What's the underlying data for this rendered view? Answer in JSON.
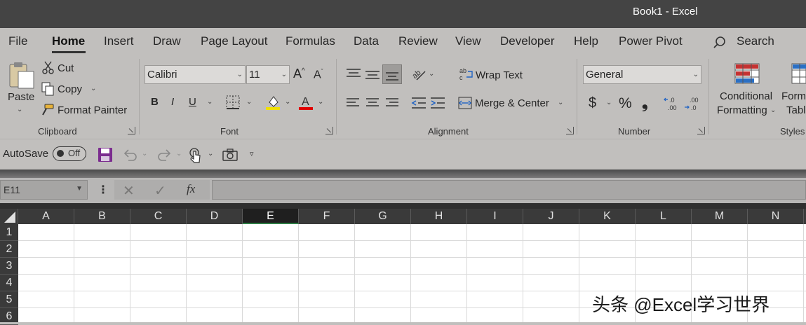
{
  "window": {
    "title": "Book1  -  Excel"
  },
  "tabs": [
    "File",
    "Home",
    "Insert",
    "Draw",
    "Page Layout",
    "Formulas",
    "Data",
    "Review",
    "View",
    "Developer",
    "Help",
    "Power Pivot"
  ],
  "search": {
    "label": "Search"
  },
  "clipboard": {
    "paste": "Paste",
    "cut": "Cut",
    "copy": "Copy",
    "format_painter": "Format Painter",
    "label": "Clipboard"
  },
  "font": {
    "name": "Calibri",
    "size": "11",
    "bold": "B",
    "italic": "I",
    "underline": "U",
    "label": "Font",
    "highlight_color": "#f0e000",
    "font_color": "#e00000"
  },
  "alignment": {
    "wrap_text": "Wrap Text",
    "merge_center": "Merge & Center",
    "label": "Alignment"
  },
  "number": {
    "format": "General",
    "currency": "$",
    "percent": "%",
    "comma": "❟",
    "label": "Number"
  },
  "styles": {
    "conditional_line1": "Conditional",
    "conditional_line2": "Formatting",
    "format_table_line1": "Forma",
    "format_table_line2": "Tabl",
    "label": "Styles"
  },
  "qat": {
    "autosave": "AutoSave",
    "toggle": "Off"
  },
  "formula_bar": {
    "name_box": "E11",
    "fx": "fx",
    "value": ""
  },
  "columns": [
    "A",
    "B",
    "C",
    "D",
    "E",
    "F",
    "G",
    "H",
    "I",
    "J",
    "K",
    "L",
    "M",
    "N"
  ],
  "selected_column": "E",
  "rows": [
    "1",
    "2",
    "3",
    "4",
    "5",
    "6"
  ],
  "watermark": "头条 @Excel学习世界"
}
